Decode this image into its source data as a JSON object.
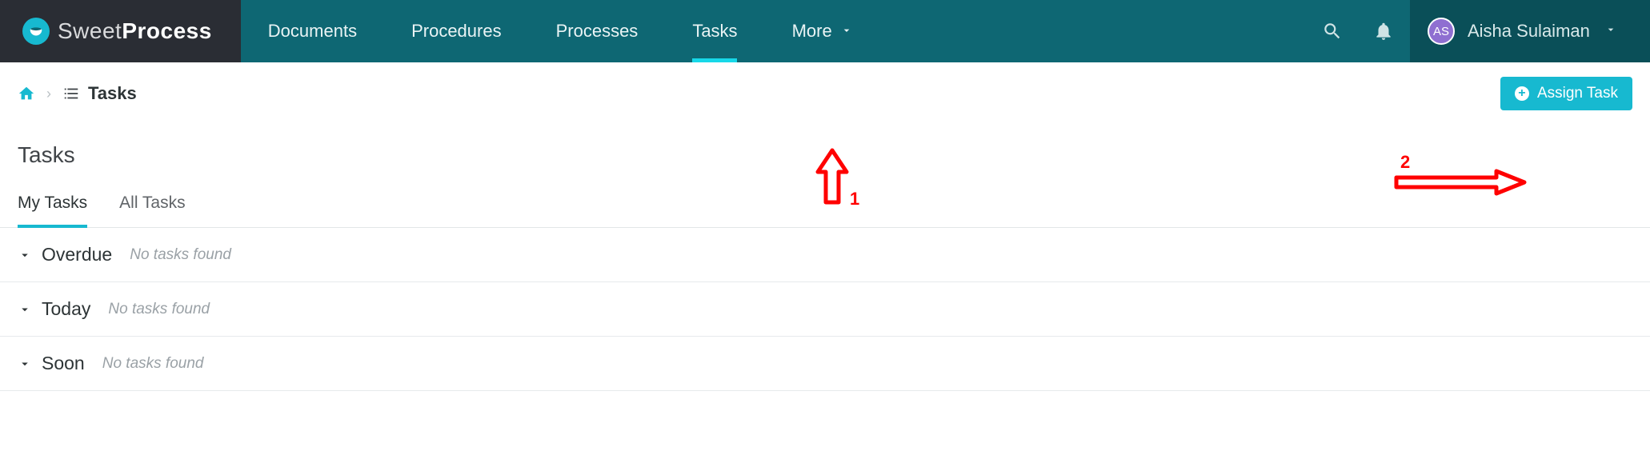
{
  "brand": {
    "name1": "Sweet",
    "name2": "Process"
  },
  "nav": {
    "documents": "Documents",
    "procedures": "Procedures",
    "processes": "Processes",
    "tasks": "Tasks",
    "more": "More"
  },
  "user": {
    "initials": "AS",
    "name": "Aisha Sulaiman"
  },
  "breadcrumb": {
    "current": "Tasks"
  },
  "assign_button": "Assign Task",
  "page_title": "Tasks",
  "tabs": {
    "my": "My Tasks",
    "all": "All Tasks"
  },
  "sections": {
    "overdue": {
      "title": "Overdue",
      "empty": "No tasks found"
    },
    "today": {
      "title": "Today",
      "empty": "No tasks found"
    },
    "soon": {
      "title": "Soon",
      "empty": "No tasks found"
    }
  },
  "annotations": {
    "one": "1",
    "two": "2"
  }
}
